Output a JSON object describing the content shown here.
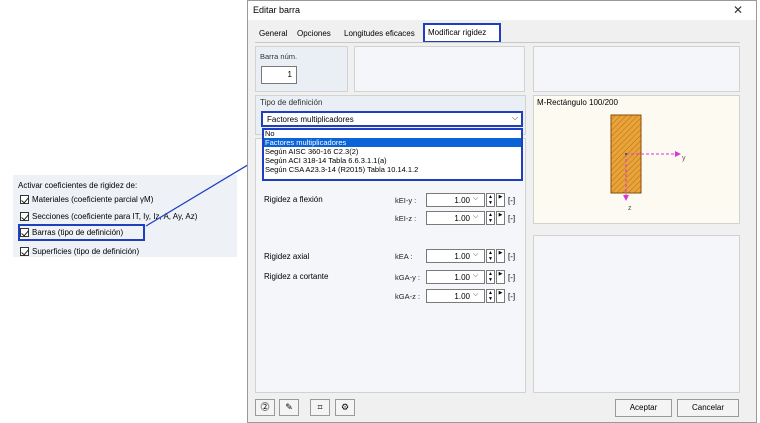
{
  "left_panel": {
    "title": "Activar coeficientes de rigidez de:",
    "items": [
      {
        "label": "Materiales (coeficiente parcial γM)",
        "checked": true
      },
      {
        "label": "Secciones (coeficiente para IT, Iy, Iz, A, Ay, Az)",
        "checked": true
      },
      {
        "label": "Barras (tipo de definición)",
        "checked": true
      },
      {
        "label": "Superficies (tipo de definición)",
        "checked": true
      }
    ]
  },
  "dialog": {
    "title": "Editar barra",
    "close_icon": "close-icon",
    "tabs": [
      "General",
      "Opciones",
      "Longitudes eficaces",
      "Modificar rigidez"
    ],
    "active_tab": "Modificar rigidez",
    "barra_num_label": "Barra núm.",
    "barra_num_value": "1",
    "tipo_label": "Tipo de definición",
    "tipo_value": "Factores multiplicadores",
    "dropdown_options": [
      "No",
      "Factores multiplicadores",
      "Según AISC 360-16 C2.3(2)",
      "Según ACI 318-14 Tabla 6.6.3.1.1(a)",
      "Según CSA A23.3-14 (R2015) Tabla 10.14.1.2"
    ],
    "dropdown_selected_index": 1,
    "rigidez": {
      "flexion_label": "Rigidez a flexión",
      "axial_label": "Rigidez axial",
      "cortante_label": "Rigidez a cortante",
      "k_ei_y": "kEI-y :",
      "k_ei_z": "kEI-z :",
      "k_ea": "kEA :",
      "k_ga_y": "kGA-y :",
      "k_ga_z": "kGA-z :",
      "value": "1.00",
      "unit": "[-]"
    },
    "preview_title": "M-Rectángulo 100/200",
    "axis_y": "y",
    "axis_z": "z",
    "ok_label": "Aceptar",
    "cancel_label": "Cancelar"
  },
  "colors": {
    "highlight": "#1f3fbf",
    "selection": "#0a64d8",
    "section_fill": "#e8a43a"
  }
}
